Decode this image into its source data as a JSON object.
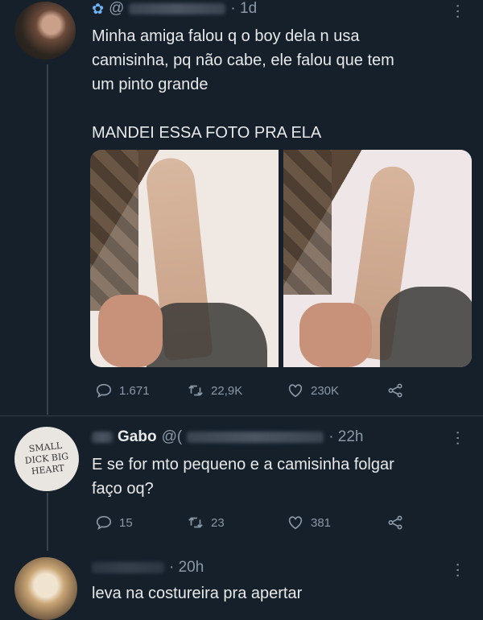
{
  "tweets": [
    {
      "handle": "@",
      "time": "· 1d",
      "text_lines": [
        "Minha amiga falou q o boy dela n usa",
        "camisinha, pq não cabe, ele falou que tem",
        "um pinto grande"
      ],
      "caption": "MANDEI ESSA FOTO PRA ELA",
      "stats": {
        "replies": "1.671",
        "retweets": "22,9K",
        "likes": "230K"
      }
    },
    {
      "name": "Gabo",
      "handle": "@(",
      "time": "· 22h",
      "avatar_text": "SMALL DICK BIG HEART",
      "text_lines": [
        "E se for mto pequeno e a camisinha folgar",
        "faço oq?"
      ],
      "stats": {
        "replies": "15",
        "retweets": "23",
        "likes": "381"
      }
    },
    {
      "name": "",
      "handle": "",
      "time": "· 20h",
      "text_lines": [
        "leva na costureira pra apertar"
      ]
    }
  ],
  "icons": {
    "reply": "reply-icon",
    "retweet": "retweet-icon",
    "like": "heart-icon",
    "share": "share-icon",
    "more": "more-icon"
  }
}
